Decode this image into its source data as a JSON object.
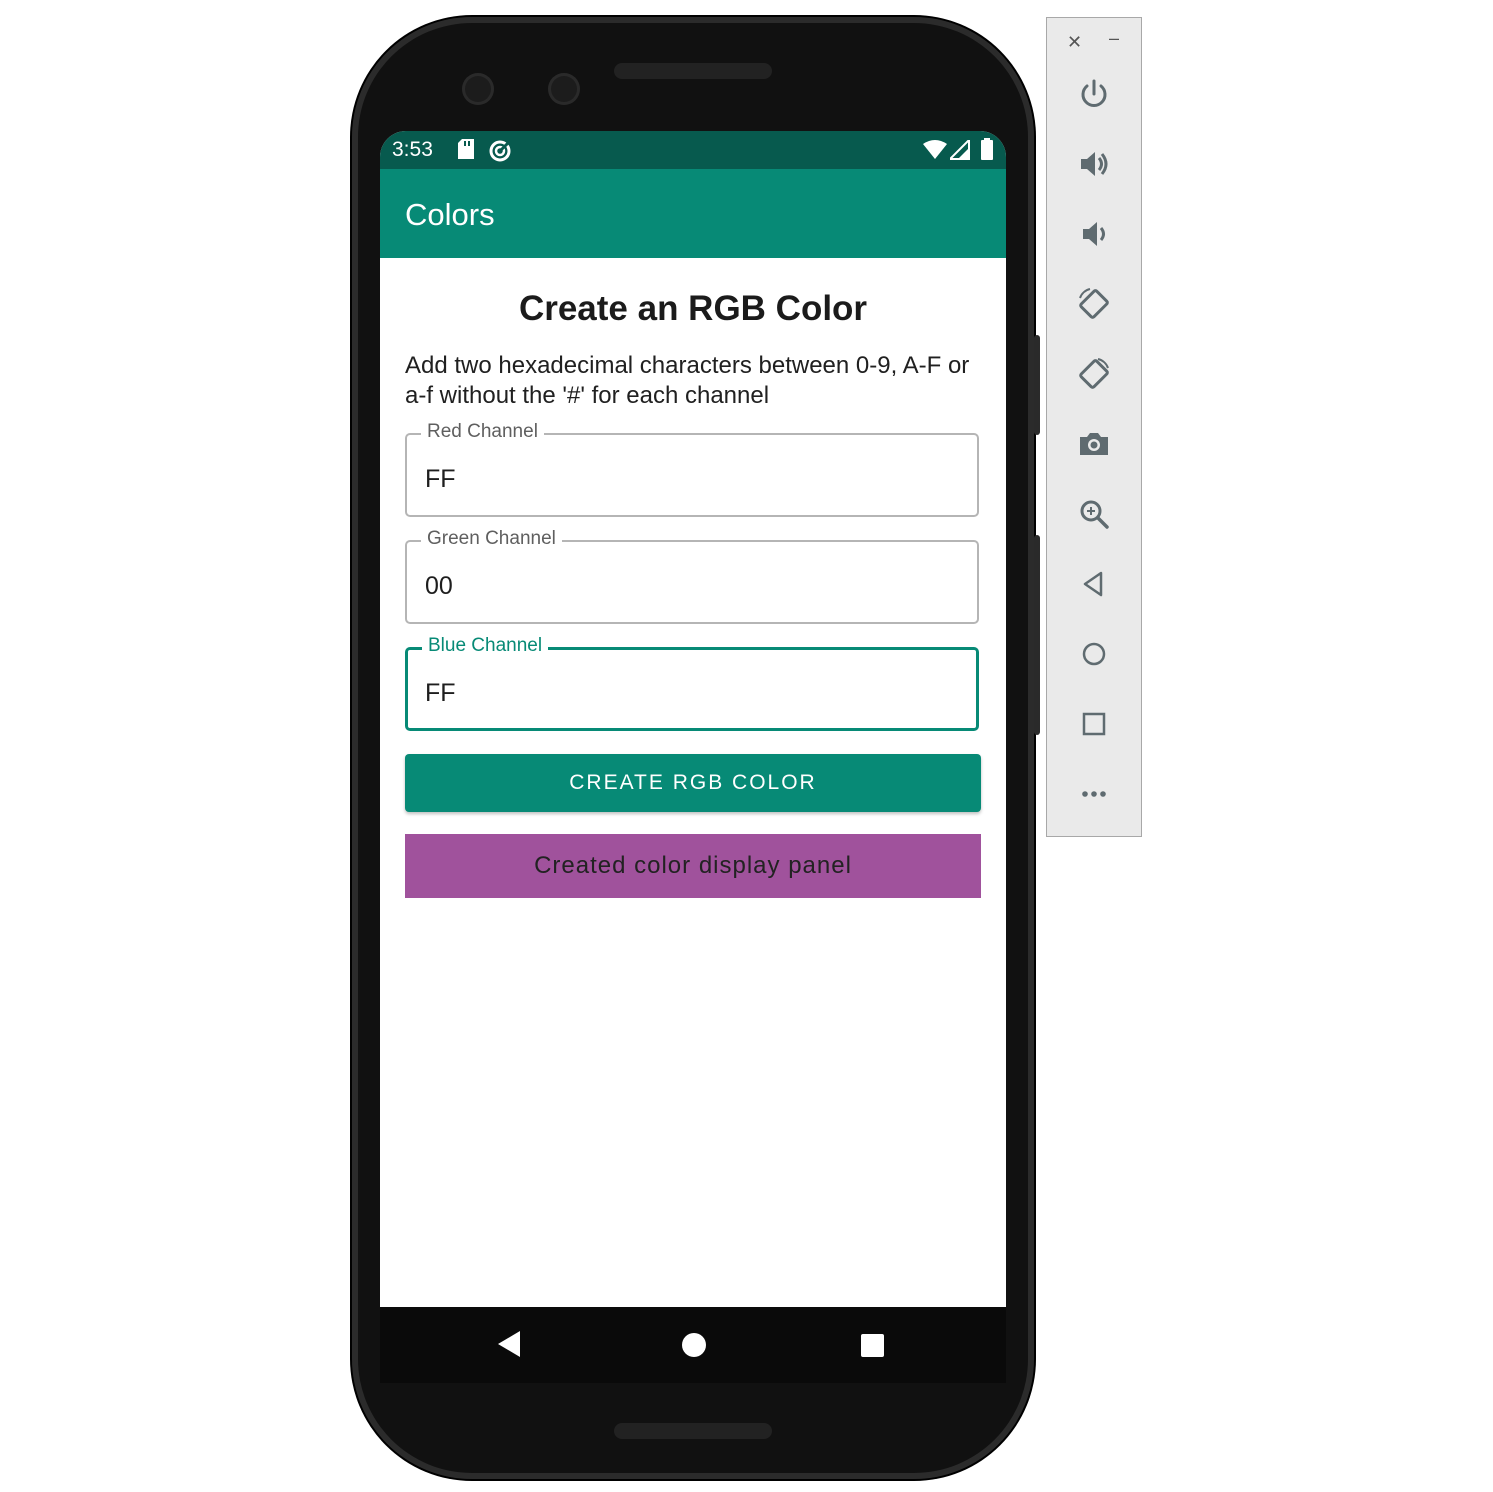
{
  "status_bar": {
    "time": "3:53"
  },
  "app_bar": {
    "title": "Colors"
  },
  "content": {
    "heading": "Create an RGB Color",
    "description": "Add two hexadecimal characters between 0-9, A-F or a-f without the '#' for each channel",
    "fields": [
      {
        "label": "Red Channel",
        "value": "FF"
      },
      {
        "label": "Green Channel",
        "value": "00"
      },
      {
        "label": "Blue Channel",
        "value": "FF"
      }
    ],
    "create_button_label": "CREATE RGB COLOR",
    "panel": {
      "label": "Created color display panel",
      "color": "#a0529c"
    }
  },
  "colors": {
    "primary": "#078a76",
    "primary_dark": "#075a4e"
  },
  "emulator_toolbar": {
    "window_controls": [
      "close-icon",
      "minimize-icon"
    ],
    "icons": [
      "power-icon",
      "volume-up-icon",
      "volume-down-icon",
      "rotate-left-icon",
      "rotate-right-icon",
      "camera-icon",
      "zoom-icon",
      "back-icon",
      "home-icon",
      "overview-icon",
      "more-icon"
    ]
  }
}
